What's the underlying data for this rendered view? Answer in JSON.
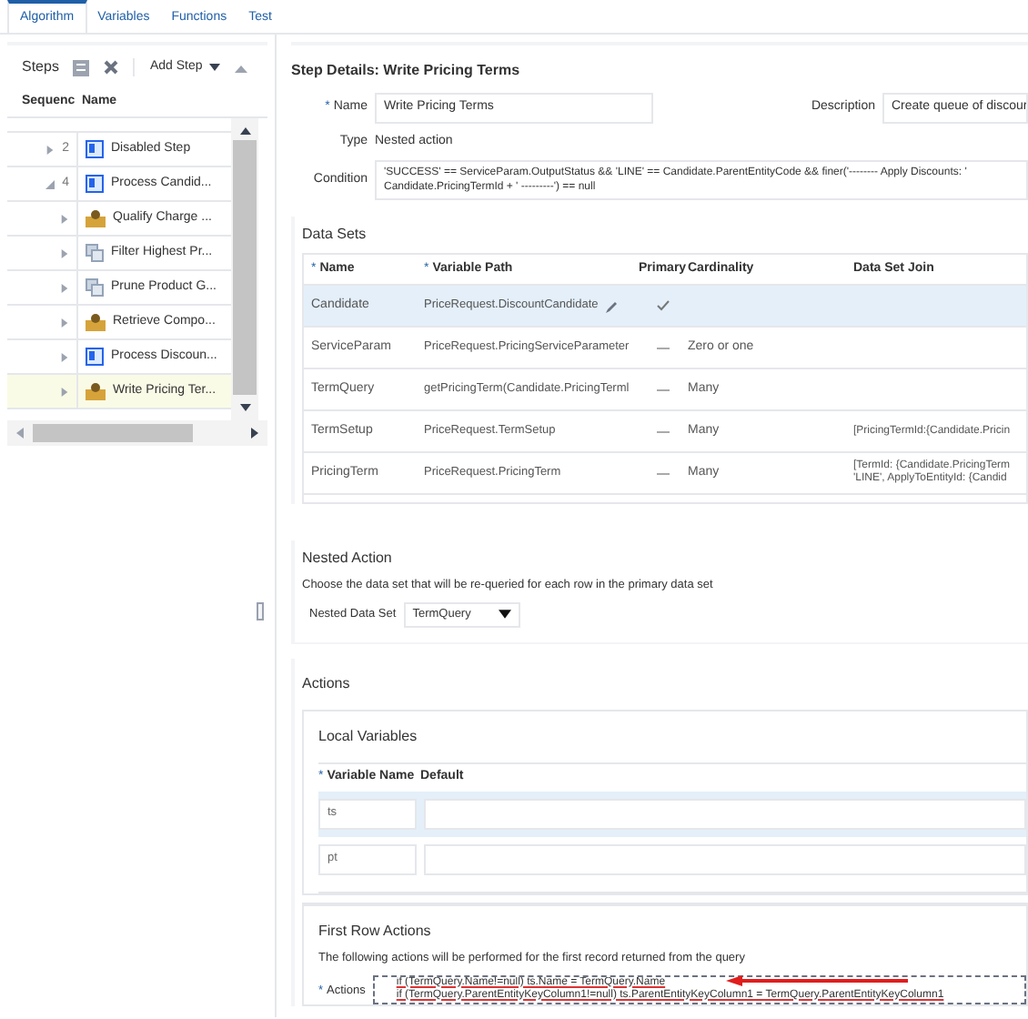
{
  "tabs": [
    {
      "label": "Algorithm",
      "selected": true
    },
    {
      "label": "Variables",
      "selected": false
    },
    {
      "label": "Functions",
      "selected": false
    },
    {
      "label": "Test",
      "selected": false
    }
  ],
  "steps_panel": {
    "title": "Steps",
    "add_step": "Add Step",
    "columns": [
      "Sequenc",
      "Name"
    ],
    "rows": [
      {
        "seq": "2",
        "expanded": false,
        "kind": "nested",
        "name": "Disabled Step",
        "selected": false
      },
      {
        "seq": "4",
        "expanded": true,
        "kind": "nested",
        "name": "Process Candid...",
        "selected": false
      },
      {
        "expanded": false,
        "kind": "rule",
        "name": "Qualify Charge ...",
        "selected": false
      },
      {
        "expanded": false,
        "kind": "filter",
        "name": "Filter Highest Pr...",
        "selected": false
      },
      {
        "expanded": false,
        "kind": "filter",
        "name": "Prune Product G...",
        "selected": false
      },
      {
        "expanded": false,
        "kind": "rule",
        "name": "Retrieve Compo...",
        "selected": false
      },
      {
        "expanded": false,
        "kind": "nested",
        "name": "Process Discoun...",
        "selected": false
      },
      {
        "expanded": false,
        "kind": "rule",
        "name": "Write Pricing Ter...",
        "selected": true
      }
    ]
  },
  "step_details": {
    "title": "Step Details: Write Pricing Terms",
    "name_mark": "*",
    "name_label": "Name",
    "name_value": "Write Pricing Terms",
    "description_label": "Description",
    "description_value": "Create queue of discour",
    "type_label": "Type",
    "type_value": "Nested action",
    "condition_label": "Condition",
    "condition_lines": [
      "'SUCCESS' == ServiceParam.OutputStatus && 'LINE' == Candidate.ParentEntityCode && finer('-------- Apply Discounts: '",
      "Candidate.PricingTermId + ' ---------') == null"
    ]
  },
  "data_sets": {
    "title": "Data Sets",
    "name_mark": "*",
    "path_mark": "*",
    "columns": [
      "Name",
      "Variable Path",
      "Primary",
      "Cardinality",
      "Data Set Join"
    ],
    "rows": [
      {
        "name": "Candidate",
        "path": "PriceRequest.DiscountCandidate",
        "primary": true,
        "selected": true
      },
      {
        "name": "ServiceParam",
        "path": "PriceRequest.PricingServiceParameter",
        "primary": false,
        "cardinality": "Zero or one",
        "selected": false
      },
      {
        "name": "TermQuery",
        "path": "getPricingTerm(Candidate.PricingTerml",
        "primary": false,
        "cardinality": "Many",
        "selected": false
      },
      {
        "name": "TermSetup",
        "path": "PriceRequest.TermSetup",
        "primary": false,
        "cardinality": "Many",
        "join": [
          "[PricingTermId:{Candidate.Pricin"
        ],
        "selected": false
      },
      {
        "name": "PricingTerm",
        "path": "PriceRequest.PricingTerm",
        "primary": false,
        "cardinality": "Many",
        "join": [
          "[TermId: {Candidate.PricingTerm",
          "'LINE', ApplyToEntityId: {Candid"
        ],
        "selected": false
      }
    ]
  },
  "nested_action": {
    "title": "Nested Action",
    "hint": "Choose the data set that will be re-queried for each row in the primary data set",
    "label": "Nested Data Set",
    "value": "TermQuery"
  },
  "actions": {
    "title": "Actions",
    "local_variables": {
      "title": "Local Variables",
      "name_mark": "*",
      "columns": [
        "Variable Name",
        "Default"
      ],
      "rows": [
        {
          "name": "ts",
          "selected": true
        },
        {
          "name": "pt",
          "selected": false
        }
      ]
    },
    "first_row": {
      "title": "First Row Actions",
      "hint": "The following actions will be performed for the first record returned from the query",
      "label_mark": "*",
      "label": "Actions",
      "lines": [
        "if (TermQuery.Name!=null) ts.Name = TermQuery.Name",
        "if (TermQuery.ParentEntityKeyColumn1!=null) ts.ParentEntityKeyColumn1 = TermQuery.ParentEntityKeyColumn1"
      ]
    }
  }
}
